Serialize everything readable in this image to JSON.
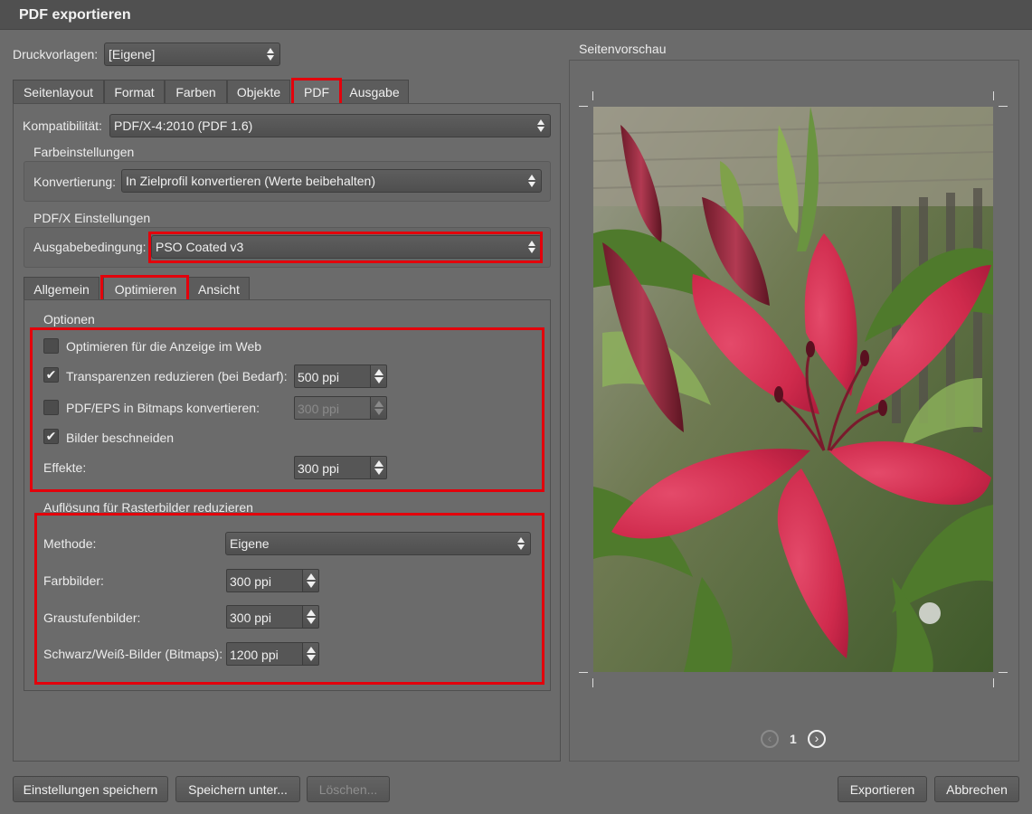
{
  "window": {
    "title": "PDF exportieren"
  },
  "presets": {
    "label": "Druckvorlagen:",
    "value": "[Eigene]"
  },
  "main_tabs": [
    "Seitenlayout",
    "Format",
    "Farben",
    "Objekte",
    "PDF",
    "Ausgabe"
  ],
  "active_main_tab": "PDF",
  "compatibility": {
    "label": "Kompatibilität:",
    "value": "PDF/X-4:2010 (PDF 1.6)"
  },
  "color_settings": {
    "heading": "Farbeinstellungen",
    "conversion_label": "Konvertierung:",
    "conversion_value": "In Zielprofil konvertieren (Werte beibehalten)"
  },
  "pdfx_settings": {
    "heading": "PDF/X Einstellungen",
    "output_condition_label": "Ausgabebedingung:",
    "output_condition_value": "PSO Coated v3"
  },
  "sub_tabs": [
    "Allgemein",
    "Optimieren",
    "Ansicht"
  ],
  "active_sub_tab": "Optimieren",
  "options": {
    "heading": "Optionen",
    "optimize_web": {
      "label": "Optimieren für die Anzeige im Web",
      "checked": false
    },
    "reduce_transparency": {
      "label": "Transparenzen reduzieren (bei Bedarf):",
      "checked": true,
      "value": "500 ppi"
    },
    "pdfeps_bitmaps": {
      "label": "PDF/EPS in Bitmaps konvertieren:",
      "checked": false,
      "value": "300 ppi",
      "disabled": true
    },
    "crop_images": {
      "label": "Bilder beschneiden",
      "checked": true
    },
    "effects": {
      "label": "Effekte:",
      "value": "300 ppi"
    }
  },
  "resolution": {
    "heading": "Auflösung für Rasterbilder reduzieren",
    "method_label": "Methode:",
    "method_value": "Eigene",
    "color_images_label": "Farbbilder:",
    "color_images_value": "300 ppi",
    "grayscale_label": "Graustufenbilder:",
    "grayscale_value": "300 ppi",
    "bw_label": "Schwarz/Weiß-Bilder (Bitmaps):",
    "bw_value": "1200 ppi"
  },
  "preview": {
    "heading": "Seitenvorschau",
    "page_number": "1",
    "prev_icon": "chevron-left-icon",
    "next_icon": "chevron-right-icon"
  },
  "buttons": {
    "save_settings": "Einstellungen speichern",
    "save_as": "Speichern unter...",
    "delete": "Löschen...",
    "export": "Exportieren",
    "cancel": "Abbrechen"
  },
  "colors": {
    "background": "#6b6b6b",
    "titlebar": "#505050",
    "highlight_red": "#e3000b",
    "flower_red": "#d42a4e"
  }
}
